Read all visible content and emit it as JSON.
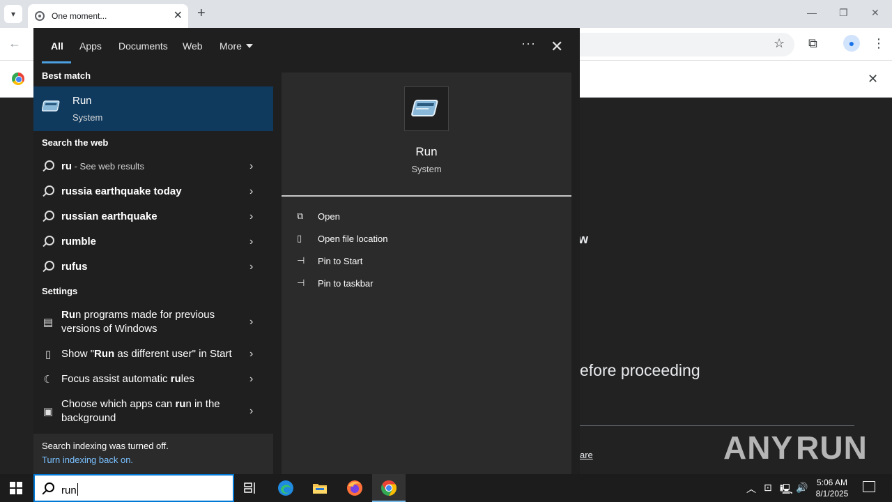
{
  "browser": {
    "tab_title": "One moment...",
    "new_tab": "+",
    "tab_close": "✕",
    "minimize": "—",
    "restore": "❐",
    "close": "✕",
    "infobar_close": "✕"
  },
  "page": {
    "partial_w": "w",
    "partial_proceed": "efore proceeding",
    "partial_link": "are",
    "watermark": "ANY RUN"
  },
  "search": {
    "tabs": [
      {
        "label": "All",
        "active": true
      },
      {
        "label": "Apps"
      },
      {
        "label": "Documents"
      },
      {
        "label": "Web"
      },
      {
        "label": "More"
      }
    ],
    "more_dots": "···",
    "close": "✕",
    "best_match_heading": "Best match",
    "best_match": {
      "title": "Run",
      "subtitle": "System"
    },
    "web_heading": "Search the web",
    "web_first": {
      "bold": "ru",
      "rest": " - See web results"
    },
    "web_results": [
      "russia earthquake today",
      "russian earthquake",
      "rumble",
      "rufus"
    ],
    "settings_heading": "Settings",
    "settings": [
      {
        "pre": "",
        "bold": "Ru",
        "post": "n programs made for previous versions of Windows"
      },
      {
        "pre": "Show \"",
        "bold": "Run",
        "post": " as different user\" in Start"
      },
      {
        "pre": "Focus assist automatic ",
        "bold": "ru",
        "post": "les"
      },
      {
        "pre": "Choose which apps can ",
        "bold": "ru",
        "post": "n in the background"
      }
    ],
    "indexing_text": "Search indexing was turned off.",
    "indexing_link": "Turn indexing back on.",
    "detail": {
      "title": "Run",
      "subtitle": "System",
      "actions": [
        "Open",
        "Open file location",
        "Pin to Start",
        "Pin to taskbar"
      ]
    }
  },
  "taskbar": {
    "search_value": "run",
    "time": "5:06 AM",
    "date": "8/1/2025"
  },
  "colors": {
    "accent": "#0078d4",
    "best_match_bg": "#0f3a5e",
    "link": "#7ac0ff"
  }
}
